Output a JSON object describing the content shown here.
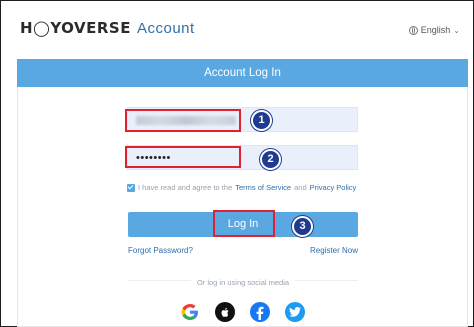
{
  "header": {
    "brand": "H◯YOVERSE",
    "account": "Account",
    "language": "English"
  },
  "card": {
    "title": "Account Log In",
    "password_mask": "••••••••",
    "agree_prefix": "I have read and agree to the",
    "terms_link": "Terms of Service",
    "and_text": "and",
    "privacy_link": "Privacy Policy",
    "login_label": "Log In",
    "forgot_link": "Forgot Password?",
    "register_link": "Register Now",
    "social_divider": "Or log in using social media"
  },
  "annotations": {
    "step1": "1",
    "step2": "2",
    "step3": "3"
  },
  "social": {
    "google": "google-icon",
    "apple": "apple-icon",
    "facebook": "facebook-icon",
    "twitter": "twitter-icon"
  },
  "colors": {
    "primary": "#5aa8e1",
    "highlight": "#e0222e",
    "badge": "#1f3b8f",
    "link": "#2f6fa8"
  }
}
